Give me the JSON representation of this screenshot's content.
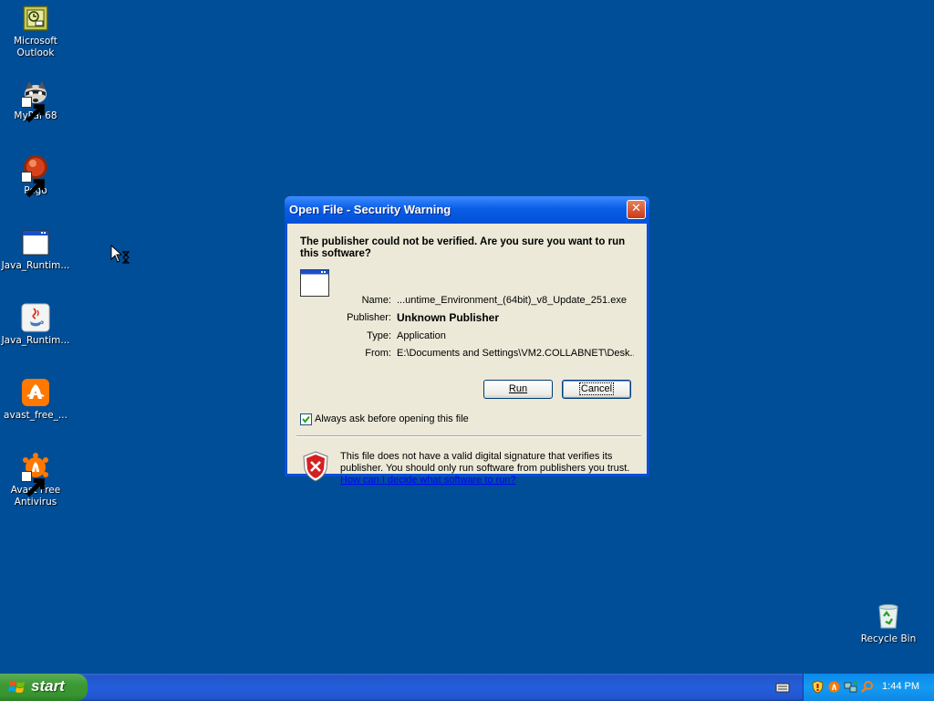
{
  "desktop": {
    "icons": [
      {
        "label": "Microsoft Outlook",
        "icon": "outlook-icon"
      },
      {
        "label": "MyPal 68",
        "icon": "mypal-raccoon-icon"
      },
      {
        "label": "Pego",
        "icon": "pego-icon"
      },
      {
        "label": "Java_Runtim...",
        "icon": "application-window-icon"
      },
      {
        "label": "Java_Runtim...",
        "icon": "java-icon"
      },
      {
        "label": "avast_free_...",
        "icon": "avast-icon"
      },
      {
        "label": "Avast Free Antivirus",
        "icon": "avast-shortcut-icon"
      },
      {
        "label": "Recycle Bin",
        "icon": "recycle-bin-icon"
      }
    ]
  },
  "dialog": {
    "title": "Open File - Security Warning",
    "close_label": "✕",
    "question": "The publisher could not be verified.  Are you sure you want to run this software?",
    "fields": [
      {
        "label": "Name:",
        "value": "...untime_Environment_(64bit)_v8_Update_251.exe"
      },
      {
        "label": "Publisher:",
        "value": "Unknown Publisher"
      },
      {
        "label": "Type:",
        "value": "Application"
      },
      {
        "label": "From:",
        "value": "E:\\Documents and Settings\\VM2.COLLABNET\\Desk..."
      }
    ],
    "run_button": "Run",
    "cancel_button": "Cancel",
    "always_ask_label": "Always ask before opening this file",
    "always_ask_checked": true,
    "warning_text": "This file does not have a valid digital signature that verifies its publisher.  You should only run software from publishers you trust.",
    "help_link": "How can I decide what software to run?"
  },
  "taskbar": {
    "start_label": "start",
    "clock": "1:44 PM"
  },
  "colors": {
    "desktop_bg": "#004e98",
    "titlebar": "#0a5ee6",
    "dialog_body": "#ece9d8",
    "start_green": "#3c9a34"
  }
}
